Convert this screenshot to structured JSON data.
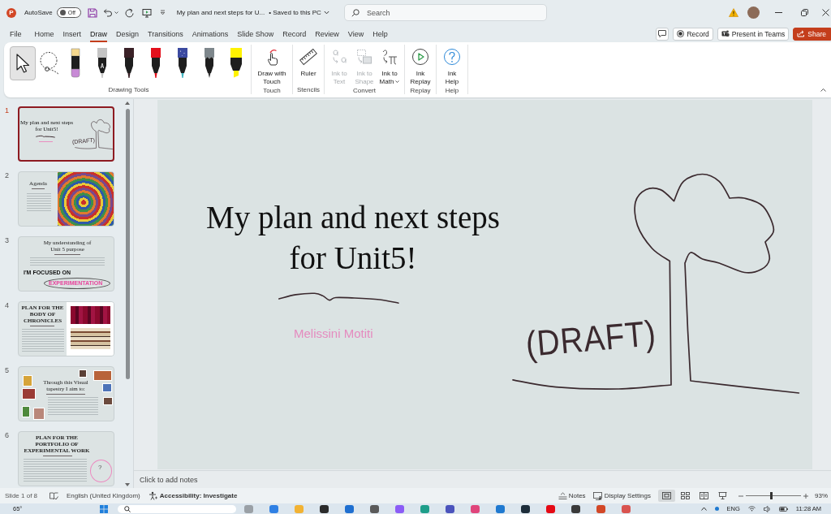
{
  "title_bar": {
    "logo": "P",
    "autosave_label": "AutoSave",
    "autosave": {
      "on": false,
      "label": "Off"
    },
    "document_title": "My plan and next steps for U...",
    "save_status": "• Saved to this PC",
    "search": {
      "placeholder": "Search"
    }
  },
  "menu": {
    "tabs": [
      {
        "label": "File",
        "selected": false
      },
      {
        "label": "Home",
        "selected": false
      },
      {
        "label": "Insert",
        "selected": false
      },
      {
        "label": "Draw",
        "selected": true
      },
      {
        "label": "Design",
        "selected": false
      },
      {
        "label": "Transitions",
        "selected": false
      },
      {
        "label": "Animations",
        "selected": false
      },
      {
        "label": "Slide Show",
        "selected": false
      },
      {
        "label": "Record",
        "selected": false
      },
      {
        "label": "Review",
        "selected": false
      },
      {
        "label": "View",
        "selected": false
      },
      {
        "label": "Help",
        "selected": false
      }
    ],
    "actions": [
      {
        "kind": "comments"
      },
      {
        "kind": "record",
        "label": "Record"
      },
      {
        "kind": "teams",
        "label": "Present in Teams"
      },
      {
        "kind": "share",
        "label": "Share"
      }
    ]
  },
  "ribbon": {
    "tool_group": {
      "label": "Drawing Tools",
      "tools": [
        {
          "kind": "select",
          "selected": true
        },
        {
          "kind": "lasso",
          "selected": false
        },
        {
          "kind": "eraser",
          "selected": false
        },
        {
          "kind": "action-pen",
          "color": "#c4c4c4",
          "selected": false
        },
        {
          "kind": "pen",
          "color": "#3a2127",
          "selected": false
        },
        {
          "kind": "pen",
          "color": "#e3101c",
          "selected": false
        },
        {
          "kind": "galaxy-pen",
          "color": "#3c4aa0",
          "selected": false
        },
        {
          "kind": "pencil",
          "color": "#7e878c",
          "selected": false
        },
        {
          "kind": "highlighter",
          "color": "#fff200",
          "selected": false
        }
      ]
    },
    "groups": [
      {
        "label": "Touch",
        "buttons": [
          {
            "kind": "touch",
            "label": "Draw with Touch",
            "disabled": false,
            "dropdown": false
          }
        ]
      },
      {
        "label": "Stencils",
        "buttons": [
          {
            "kind": "ruler",
            "label": "Ruler",
            "disabled": false,
            "dropdown": false
          }
        ]
      },
      {
        "label": "Convert",
        "buttons": [
          {
            "kind": "ink-to-text",
            "label": "Ink to Text",
            "disabled": true,
            "dropdown": false
          },
          {
            "kind": "ink-to-shape",
            "label": "Ink to Shape",
            "disabled": true,
            "dropdown": false
          },
          {
            "kind": "ink-to-math",
            "label": "Ink to Math",
            "disabled": false,
            "dropdown": true
          }
        ]
      },
      {
        "label": "Replay",
        "buttons": [
          {
            "kind": "replay",
            "label": "Ink Replay",
            "disabled": false,
            "dropdown": false
          }
        ]
      },
      {
        "label": "Help",
        "buttons": [
          {
            "kind": "help",
            "label": "Ink Help",
            "disabled": false,
            "dropdown": false
          }
        ]
      }
    ]
  },
  "slides": [
    {
      "number": "1",
      "selected": true,
      "kind": "title",
      "title": "My plan and next steps for Unit5!",
      "ink_text": "(DRAFT)"
    },
    {
      "number": "2",
      "selected": false,
      "kind": "agenda",
      "title": "Agenda"
    },
    {
      "number": "3",
      "selected": false,
      "kind": "statement",
      "title": "My understanding of Unit 5 purpose",
      "focus_label": "I'M FOCUSED ON",
      "focus_word": "EXPERIMENTATION"
    },
    {
      "number": "4",
      "selected": false,
      "kind": "plan-images",
      "title": "PLAN FOR THE BODY OF CHRONICLES"
    },
    {
      "number": "5",
      "selected": false,
      "kind": "gallery",
      "title": "Through this Visual tapestry I aim to:"
    },
    {
      "number": "6",
      "selected": false,
      "kind": "portfolio",
      "title": "PLAN FOR THE PORTFOLIO OF EXPERIMENTAL WORK",
      "ink_mark": "?"
    }
  ],
  "slide": {
    "title": "My plan and next steps for Unit5!",
    "author": "Melissini Motiti",
    "ink_text": "(DRAFT)"
  },
  "notes": {
    "placeholder": "Click to add notes"
  },
  "status_bar": {
    "slide_position": "Slide 1 of 8",
    "language": "English (United Kingdom)",
    "accessibility": "Accessibility: Investigate",
    "notes_label": "Notes",
    "display_label": "Display Settings",
    "views": [
      {
        "kind": "normal",
        "selected": true
      },
      {
        "kind": "sorter",
        "selected": false
      },
      {
        "kind": "reading",
        "selected": false
      },
      {
        "kind": "slideshow",
        "selected": false
      }
    ],
    "zoom": {
      "level": 0.46,
      "reading": "93%"
    }
  },
  "taskbar": {
    "weather": "65°",
    "language": "ENG",
    "time": "11:28 AM"
  }
}
